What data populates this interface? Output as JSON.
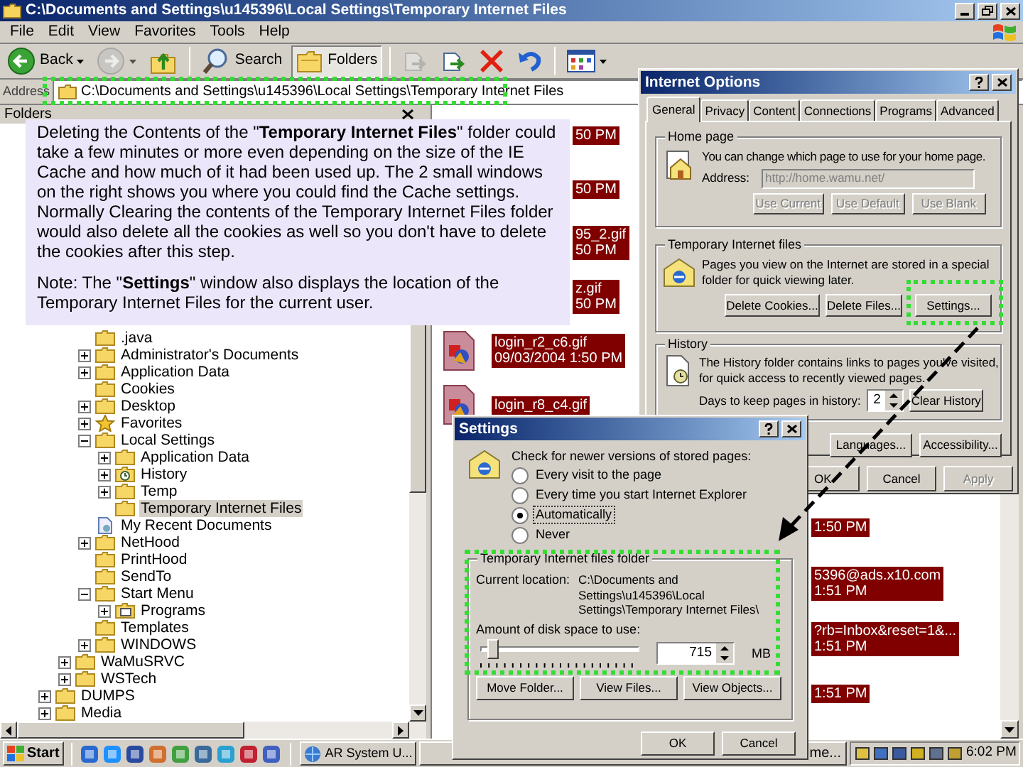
{
  "explorer": {
    "title": "C:\\Documents and Settings\\u145396\\Local Settings\\Temporary Internet Files",
    "menu": [
      "File",
      "Edit",
      "View",
      "Favorites",
      "Tools",
      "Help"
    ],
    "toolbar": [
      {
        "kind": "back",
        "label": "Back",
        "pressed": false,
        "disabled": false
      },
      {
        "kind": "forward",
        "pressed": false,
        "disabled": true
      },
      {
        "kind": "up",
        "pressed": false,
        "disabled": false
      },
      {
        "kind": "search",
        "label": "Search",
        "pressed": false,
        "disabled": false
      },
      {
        "kind": "folders",
        "label": "Folders",
        "pressed": true,
        "disabled": false
      },
      {
        "kind": "move",
        "pressed": false,
        "disabled": true
      },
      {
        "kind": "copy",
        "pressed": false,
        "disabled": false
      },
      {
        "kind": "delete",
        "pressed": false,
        "disabled": false
      },
      {
        "kind": "undo",
        "pressed": false,
        "disabled": false
      },
      {
        "kind": "views",
        "pressed": false,
        "disabled": false
      }
    ],
    "address": {
      "label": "Address",
      "value": "C:\\Documents and Settings\\u145396\\Local Settings\\Temporary Internet Files"
    },
    "folders_pane": {
      "title": "Folders",
      "tree": [
        {
          "children": [
            {
              "children": [
                {
                  "label": ".java",
                  "kind": "folder",
                  "selected": false
                },
                {
                  "label": "Administrator's Documents",
                  "kind": "folder",
                  "expanded": false,
                  "selected": false
                },
                {
                  "label": "Application Data",
                  "kind": "folder",
                  "expanded": false,
                  "selected": false
                },
                {
                  "label": "Cookies",
                  "kind": "folder",
                  "selected": false
                },
                {
                  "label": "Desktop",
                  "kind": "folder",
                  "expanded": false,
                  "selected": false
                },
                {
                  "label": "Favorites",
                  "kind": "favorites",
                  "expanded": false,
                  "selected": false
                },
                {
                  "label": "Local Settings",
                  "kind": "folder",
                  "expanded": true,
                  "selected": false,
                  "children": [
                    {
                      "label": "Application Data",
                      "kind": "folder",
                      "expanded": false,
                      "selected": false
                    },
                    {
                      "label": "History",
                      "kind": "history",
                      "expanded": false,
                      "selected": false
                    },
                    {
                      "label": "Temp",
                      "kind": "folder",
                      "expanded": false,
                      "selected": false
                    },
                    {
                      "label": "Temporary Internet Files",
                      "kind": "folder",
                      "selected": true
                    }
                  ]
                },
                {
                  "label": "My Recent Documents",
                  "kind": "recent",
                  "selected": false
                },
                {
                  "label": "NetHood",
                  "kind": "folder",
                  "expanded": false,
                  "selected": false
                },
                {
                  "label": "PrintHood",
                  "kind": "folder",
                  "selected": false
                },
                {
                  "label": "SendTo",
                  "kind": "folder",
                  "selected": false
                },
                {
                  "label": "Start Menu",
                  "kind": "folder",
                  "expanded": true,
                  "selected": false,
                  "children": [
                    {
                      "label": "Programs",
                      "kind": "programs",
                      "expanded": false,
                      "selected": false
                    }
                  ]
                },
                {
                  "label": "Templates",
                  "kind": "folder",
                  "selected": false
                },
                {
                  "label": "WINDOWS",
                  "kind": "folder",
                  "expanded": false,
                  "selected": false
                }
              ]
            },
            {
              "label": "WaMuSRVC",
              "kind": "folder",
              "expanded": false,
              "selected": false
            },
            {
              "label": "WSTech",
              "kind": "folder",
              "expanded": false,
              "selected": false
            }
          ]
        },
        {
          "label": "DUMPS",
          "kind": "folder",
          "expanded": false,
          "selected": false
        },
        {
          "label": "Media",
          "kind": "folder",
          "expanded": false,
          "selected": false
        }
      ]
    },
    "files": [
      {
        "kind": "covered",
        "lines": [
          "50 PM"
        ],
        "selected": true
      },
      {
        "kind": "covered",
        "lines": [
          "50 PM"
        ],
        "selected": true
      },
      {
        "kind": "covered",
        "lines": [
          "95_2.gif",
          "50 PM"
        ],
        "selected": true
      },
      {
        "kind": "covered",
        "lines": [
          "z.gif",
          "50 PM"
        ],
        "selected": true
      },
      {
        "kind": "full",
        "lines": [
          "login_r2_c6.gif",
          "09/03/2004 1:50 PM"
        ],
        "selected": true
      },
      {
        "kind": "full",
        "lines": [
          "login_r8_c4.gif"
        ],
        "selected": true
      }
    ],
    "files_behind_dialog": [
      {
        "lines": [
          "1:50 PM"
        ],
        "selected": true
      },
      {
        "lines": [
          "5396@ads.x10.com",
          "1:51 PM"
        ],
        "selected": true
      },
      {
        "lines": [
          "?rb=Inbox&reset=1&...",
          "1:51 PM"
        ],
        "selected": true
      },
      {
        "lines": [
          "1:51 PM"
        ],
        "selected": true
      }
    ]
  },
  "callout": {
    "paragraphs": [
      "Deleting the Contents of the \"**Temporary Internet Files**\" folder could take a few minutes or more even depending on the size of the IE Cache and how much of it had been used up. The 2 small windows on the right shows you where you could find the Cache settings. Normally Clearing the contents of the Temporary Internet Files folder would also delete all the cookies as well so you don't have to delete the cookies after this step.",
      "Note: The \"**Settings**\" window also displays the location of the Temporary Internet Files for the current user."
    ]
  },
  "internet_options": {
    "title": "Internet Options",
    "tabs": [
      {
        "label": "General",
        "selected": true
      },
      {
        "label": "Privacy",
        "selected": false
      },
      {
        "label": "Content",
        "selected": false
      },
      {
        "label": "Connections",
        "selected": false
      },
      {
        "label": "Programs",
        "selected": false
      },
      {
        "label": "Advanced",
        "selected": false
      }
    ],
    "home_page": {
      "title": "Home page",
      "text": "You can change which page to use for your home page.",
      "address_label": "Address:",
      "address_value": "http://home.wamu.net/",
      "address_disabled": true,
      "buttons": [
        {
          "label": "Use Current",
          "disabled": true
        },
        {
          "label": "Use Default",
          "disabled": true
        },
        {
          "label": "Use Blank",
          "disabled": true
        }
      ]
    },
    "temporary_files": {
      "title": "Temporary Internet files",
      "text": "Pages you view on the Internet are stored in a special folder for quick viewing later.",
      "buttons": [
        {
          "label": "Delete Cookies...",
          "disabled": false
        },
        {
          "label": "Delete Files...",
          "disabled": false
        },
        {
          "label": "Settings...",
          "disabled": false
        }
      ]
    },
    "history": {
      "title": "History",
      "text": "The History folder contains links to pages you've visited, for quick access to recently viewed pages.",
      "days_label": "Days to keep pages in history:",
      "days_value": "2",
      "button": "Clear History"
    },
    "panel_buttons": [
      "Languages...",
      "Accessibility..."
    ],
    "buttons": [
      {
        "label": "OK",
        "disabled": false
      },
      {
        "label": "Cancel",
        "disabled": false
      },
      {
        "label": "Apply",
        "disabled": true
      }
    ]
  },
  "settings": {
    "title": "Settings",
    "prompt": "Check for newer versions of stored pages:",
    "options": [
      {
        "label": "Every visit to the page",
        "selected": false
      },
      {
        "label": "Every time you start Internet Explorer",
        "selected": false
      },
      {
        "label": "Automatically",
        "selected": true
      },
      {
        "label": "Never",
        "selected": false
      }
    ],
    "folder_group": {
      "title": "Temporary Internet files folder",
      "location_label": "Current location:",
      "location": "C:\\Documents and\nSettings\\u145396\\Local\nSettings\\Temporary Internet Files\\",
      "disk_label": "Amount of disk space to use:",
      "level": 0.05,
      "disk_value": "715",
      "unit": "MB",
      "buttons": [
        "Move Folder...",
        "View Files...",
        "View Objects..."
      ]
    },
    "buttons": [
      "OK",
      "Cancel"
    ]
  },
  "taskbar": {
    "start": "Start",
    "tasks": [
      {
        "label": "AR System U..."
      },
      {
        "label": "me..."
      }
    ],
    "clock": "6:02 PM"
  }
}
